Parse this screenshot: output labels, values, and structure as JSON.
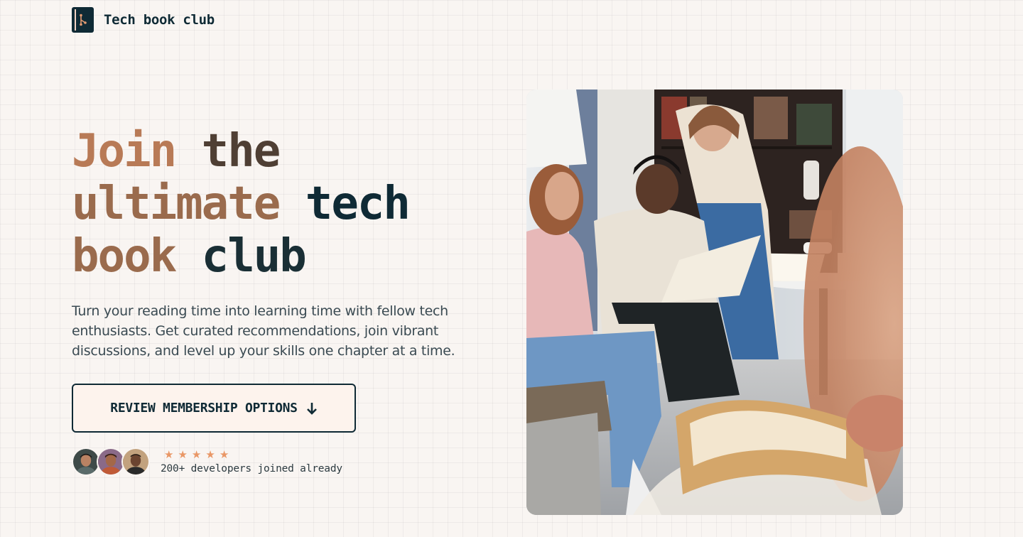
{
  "nav": {
    "brand": "Tech book club",
    "logo_icon": "book-logo-icon"
  },
  "hero": {
    "title_line1_a": "Join",
    "title_line1_b": "the",
    "title_line2_a": "ultimate",
    "title_line2_b": "tech",
    "title_line3_a": "book",
    "title_line3_b": "club",
    "lead": "Turn your reading time into learning time with fellow tech enthusiasts. Get curated recommendations, join vibrant discussions, and level up your skills one chapter at a time.",
    "cta_label": "REVIEW MEMBERSHIP OPTIONS",
    "cta_icon": "arrow-down-icon"
  },
  "social_proof": {
    "stars": 5,
    "text": "200+ developers joined already"
  },
  "colors": {
    "background": "#f9f5f2",
    "primary": "#0f2a35",
    "accent": "#b87a56",
    "star": "#e99766"
  }
}
